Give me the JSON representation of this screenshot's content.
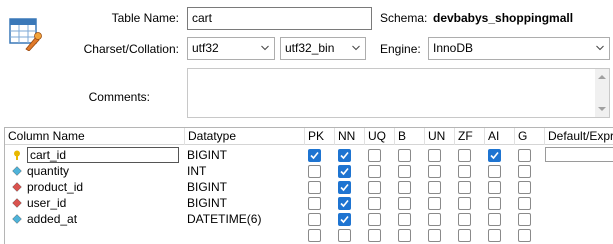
{
  "icon": "table-settings-icon",
  "labels": {
    "table_name": "Table Name:",
    "schema": "Schema:",
    "charset": "Charset/Collation:",
    "engine": "Engine:",
    "comments": "Comments:"
  },
  "fields": {
    "table_name": "cart",
    "schema": "devbabys_shoppingmall",
    "charset": "utf32",
    "collation": "utf32_bin",
    "engine": "InnoDB",
    "comments": ""
  },
  "columns_header": [
    "Column Name",
    "Datatype",
    "PK",
    "NN",
    "UQ",
    "B",
    "UN",
    "ZF",
    "AI",
    "G",
    "Default/Expre"
  ],
  "rows": [
    {
      "name": "cart_id",
      "datatype": "BIGINT",
      "marker": "key",
      "flags": [
        true,
        true,
        false,
        false,
        false,
        false,
        true,
        false
      ],
      "editing": true
    },
    {
      "name": "quantity",
      "datatype": "INT",
      "marker": "diamond-blue",
      "flags": [
        false,
        true,
        false,
        false,
        false,
        false,
        false,
        false
      ],
      "editing": false
    },
    {
      "name": "product_id",
      "datatype": "BIGINT",
      "marker": "diamond-red",
      "flags": [
        false,
        true,
        false,
        false,
        false,
        false,
        false,
        false
      ],
      "editing": false
    },
    {
      "name": "user_id",
      "datatype": "BIGINT",
      "marker": "diamond-red",
      "flags": [
        false,
        true,
        false,
        false,
        false,
        false,
        false,
        false
      ],
      "editing": false
    },
    {
      "name": "added_at",
      "datatype": "DATETIME(6)",
      "marker": "diamond-blue",
      "flags": [
        false,
        true,
        false,
        false,
        false,
        false,
        false,
        false
      ],
      "editing": false
    },
    {
      "name": "",
      "datatype": "",
      "marker": "",
      "flags": [
        false,
        false,
        false,
        false,
        false,
        false,
        false,
        false
      ],
      "editing": false
    }
  ],
  "colors": {
    "checked": "#1e74d1",
    "key": "#e8b800",
    "fk": "#d9534f",
    "col": "#4fb3d9"
  }
}
